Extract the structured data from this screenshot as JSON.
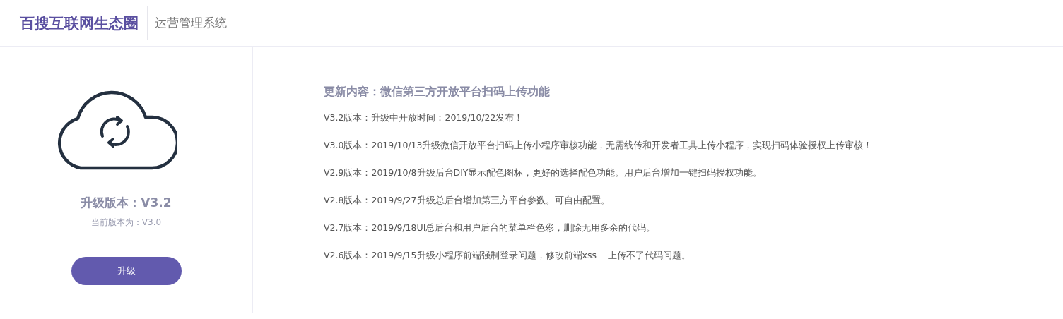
{
  "header": {
    "logo": "百搜互联网生态圈",
    "subtitle": "运营管理系统"
  },
  "upgrade": {
    "title": "升级版本：V3.2",
    "current": "当前版本为：V3.0",
    "button": "升级"
  },
  "changelog": {
    "heading": "更新内容：微信第三方开放平台扫码上传功能",
    "entries": [
      "V3.2版本：升级中开放时间：2019/10/22发布！",
      "V3.0版本：2019/10/13升级微信开放平台扫码上传小程序审核功能，无需线传和开发者工具上传小程序，实现扫码体验授权上传审核！",
      "V2.9版本：2019/10/8升级后台DIY显示配色图标，更好的选择配色功能。用户后台增加一键扫码授权功能。",
      "V2.8版本：2019/9/27升级总后台增加第三方平台参数。可自由配置。",
      "V2.7版本：2019/9/18UI总后台和用户后台的菜单栏色彩，删除无用多余的代码。",
      "V2.6版本：2019/9/15升级小程序前端强制登录问题，修改前端xss__ 上传不了代码问题。"
    ]
  }
}
